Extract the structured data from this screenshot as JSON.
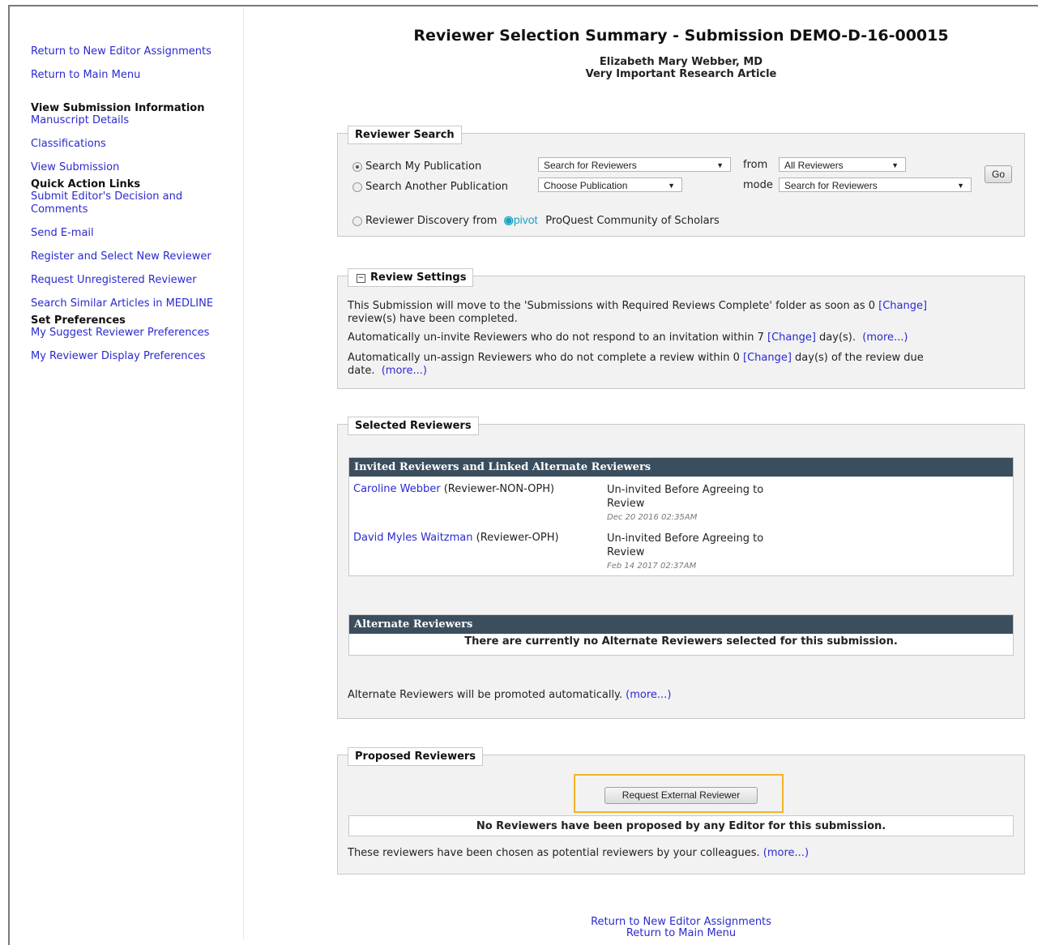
{
  "sidebar": {
    "links_top": [
      "Return to New Editor Assignments",
      "Return to Main Menu"
    ],
    "view_submission_head": "View Submission Information",
    "view_submission_links": [
      "Manuscript Details",
      "Classifications",
      "View Submission"
    ],
    "quick_action_head": "Quick Action Links",
    "quick_action_links": [
      "Submit Editor's Decision and Comments",
      "Send E-mail",
      "Register and Select New Reviewer",
      "Request Unregistered Reviewer",
      "Search Similar Articles in MEDLINE"
    ],
    "preferences_head": "Set Preferences",
    "preferences_links": [
      "My Suggest Reviewer Preferences",
      "My Reviewer Display Preferences"
    ]
  },
  "header": {
    "title": "Reviewer Selection Summary - Submission DEMO-D-16-00015",
    "author": "Elizabeth Mary Webber, MD",
    "article": "Very Important Research Article"
  },
  "search": {
    "legend": "Reviewer Search",
    "opt_my": "Search My Publication",
    "opt_another": "Search Another Publication",
    "opt_discovery": "Reviewer Discovery from",
    "pivot_logo": "pivot",
    "proquest": "ProQuest Community of Scholars",
    "select_search": "Search for Reviewers",
    "select_publication": "Choose Publication",
    "from_label": "from",
    "select_from": "All Reviewers",
    "mode_label": "mode",
    "select_mode": "Search for Reviewers",
    "go": "Go"
  },
  "settings": {
    "legend": "Review Settings",
    "collapse_icon": "minus-box-icon",
    "line1_a": "This Submission will move to the 'Submissions with Required Reviews Complete' folder as soon as 0 ",
    "line1_b": "review(s) have been completed.",
    "line2_a": "Automatically un-invite Reviewers who do not respond to an invitation within 7 ",
    "line2_b": " day(s).",
    "line3_a": "Automatically un-assign Reviewers who do not complete a review within 0 ",
    "line3_b": " day(s) of the review due",
    "line3_c": "date.",
    "change": "[Change]",
    "more": "(more...)"
  },
  "selected": {
    "legend": "Selected Reviewers",
    "invited_head": "Invited Reviewers and Linked Alternate Reviewers",
    "rows": [
      {
        "name": "Caroline Webber",
        "role": "(Reviewer-NON-OPH)",
        "status1": "Un-invited Before Agreeing to",
        "status2": "Review",
        "date": "Dec 20 2016 02:35AM"
      },
      {
        "name": "David Myles Waitzman",
        "role": "(Reviewer-OPH)",
        "status1": "Un-invited Before Agreeing to",
        "status2": "Review",
        "date": "Feb 14 2017 02:37AM"
      }
    ],
    "alternate_head": "Alternate Reviewers",
    "alternate_empty": "There are currently no Alternate Reviewers selected for this submission.",
    "alternate_note": "Alternate Reviewers will be promoted automatically.",
    "more": "(more...)"
  },
  "proposed": {
    "legend": "Proposed Reviewers",
    "request_button": "Request External Reviewer",
    "empty": "No Reviewers have been proposed by any Editor for this submission.",
    "note": "These reviewers have been chosen as potential reviewers by your colleagues.",
    "more": "(more...)",
    "highlight_color": "#f0b429"
  },
  "footer": {
    "links": [
      "Return to New Editor Assignments",
      "Return to Main Menu"
    ]
  },
  "colors": {
    "link": "#2a2ad0",
    "table_header": "#3b4e5e"
  }
}
